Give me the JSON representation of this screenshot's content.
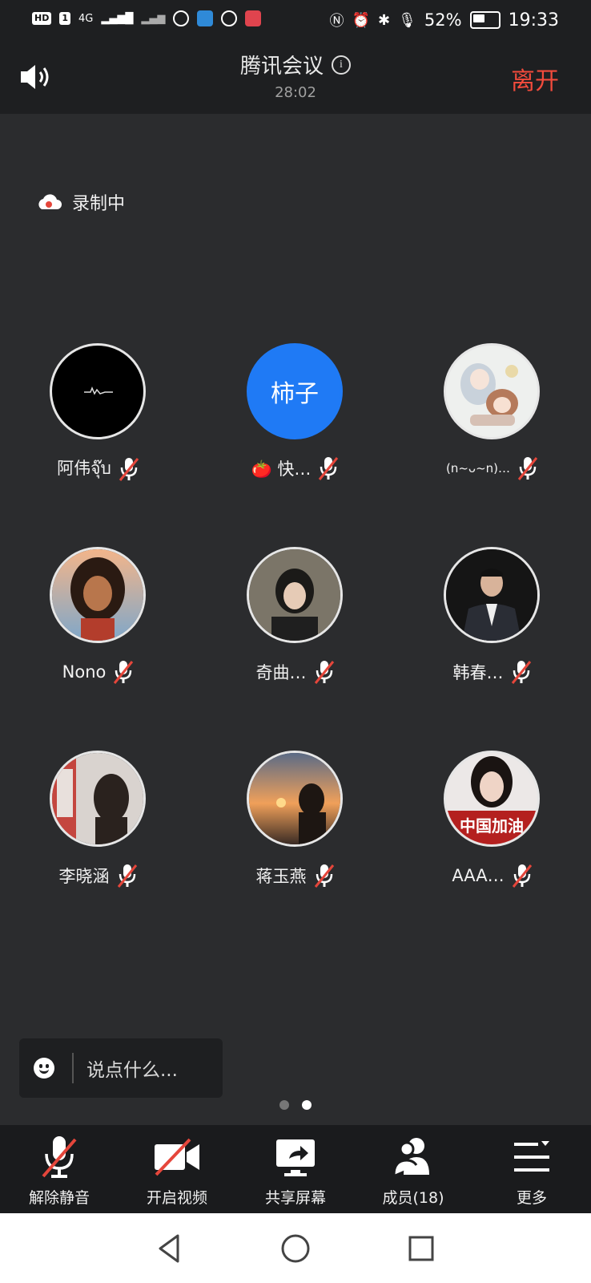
{
  "status_bar": {
    "left_chips": [
      "HD",
      "1"
    ],
    "network": "4G",
    "battery": "52%",
    "time": "19:33"
  },
  "header": {
    "title": "腾讯会议",
    "duration": "28:02",
    "leave_label": "离开"
  },
  "recording": {
    "label": "录制中"
  },
  "participants": [
    {
      "name": "阿伟จุ๊บ",
      "avatar": "dark-signature",
      "muted": true
    },
    {
      "name": "🍅 快…",
      "avatar_text": "柿子",
      "avatar": "blue-text",
      "muted": true
    },
    {
      "name": "(n~ᴗ~n)…",
      "avatar": "anime-illustration",
      "muted": true
    },
    {
      "name": "Nono",
      "avatar": "cartoon-girl",
      "muted": true
    },
    {
      "name": "奇曲…",
      "avatar": "photo-girl",
      "muted": true
    },
    {
      "name": "韩春…",
      "avatar": "photo-man-suit",
      "muted": true
    },
    {
      "name": "李晓涵",
      "avatar": "photo-shop",
      "muted": true
    },
    {
      "name": "蒋玉燕",
      "avatar": "photo-sunset",
      "muted": true
    },
    {
      "name": "AAA…",
      "avatar_text": "中国加油",
      "avatar": "photo-woman-banner",
      "muted": true
    }
  ],
  "chat": {
    "placeholder": "说点什么..."
  },
  "pager": {
    "pages": 2,
    "active": 2
  },
  "toolbar": {
    "unmute": "解除静音",
    "video": "开启视频",
    "share": "共享屏幕",
    "members": "成员(18)",
    "more": "更多"
  },
  "colors": {
    "leave": "#f24b3c",
    "accent_blue": "#1f7af5",
    "mute_red": "#e5463b"
  }
}
